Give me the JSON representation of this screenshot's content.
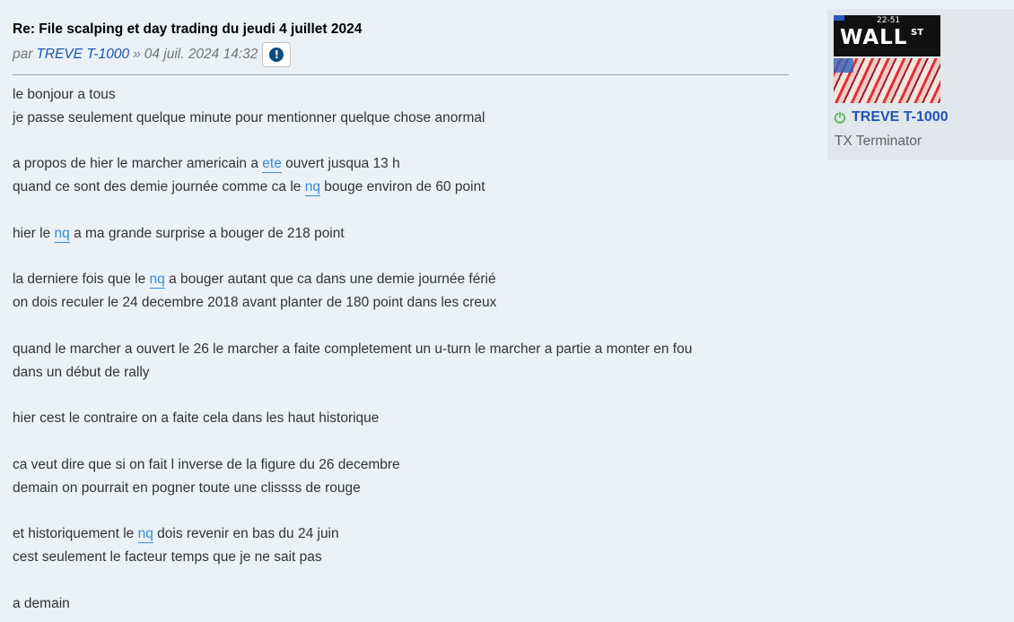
{
  "post": {
    "title": "Re: File scalping et day trading du jeudi 4 juillet 2024",
    "by_label": "par",
    "author": "TREVE T-1000",
    "separator": "»",
    "date": "04 juil. 2024 14:32",
    "report_icon": "report-icon"
  },
  "content": {
    "line01": "le bonjour a tous",
    "line02": "je passe seulement quelque minute pour mentionner quelque chose anormal",
    "line04a": "a propos de hier le marcher americain a ",
    "line04_kw": "ete",
    "line04b": " ouvert jusqua 13 h",
    "line05a": "quand ce sont des demie journée comme ca le ",
    "line05_kw": "nq",
    "line05b": " bouge environ de 60 point",
    "line07a": "hier le ",
    "line07_kw": "nq",
    "line07b": " a ma grande surprise a bouger de 218 point",
    "line09a": "la derniere fois que le ",
    "line09_kw": "nq",
    "line09b": " a bouger autant que ca dans une demie journée férié",
    "line10": "on dois reculer le 24 decembre 2018 avant planter de 180 point dans les creux",
    "line12": "quand le marcher a ouvert le 26 le marcher a faite completement un u-turn le marcher a partie a monter en fou",
    "line13": "dans un début de rally",
    "line15": "hier cest le contraire on a faite cela dans les haut historique",
    "line17": "ca veut dire que si on fait l inverse de la figure du 26 decembre",
    "line18": "demain on pourrait en pogner toute une clissss de rouge",
    "line20a": "et historiquement le ",
    "line20_kw": "nq",
    "line20b": " dois revenir en bas du 24 juin",
    "line21": "cest seulement le facteur temps que je ne sait pas",
    "line23": "a demain"
  },
  "profile": {
    "avatar_top_number": "22-51",
    "avatar_sign_text": "WALL",
    "avatar_sign_suffix": "ST",
    "name": "TREVE T-1000",
    "rank": "TX Terminator",
    "status_icon": "online-icon"
  },
  "colors": {
    "background": "#eaf1f7",
    "profile_background": "#e1e7ec",
    "link": "#1f54b0",
    "keyword_link": "#3b8bd6",
    "online": "#5cb85c"
  }
}
